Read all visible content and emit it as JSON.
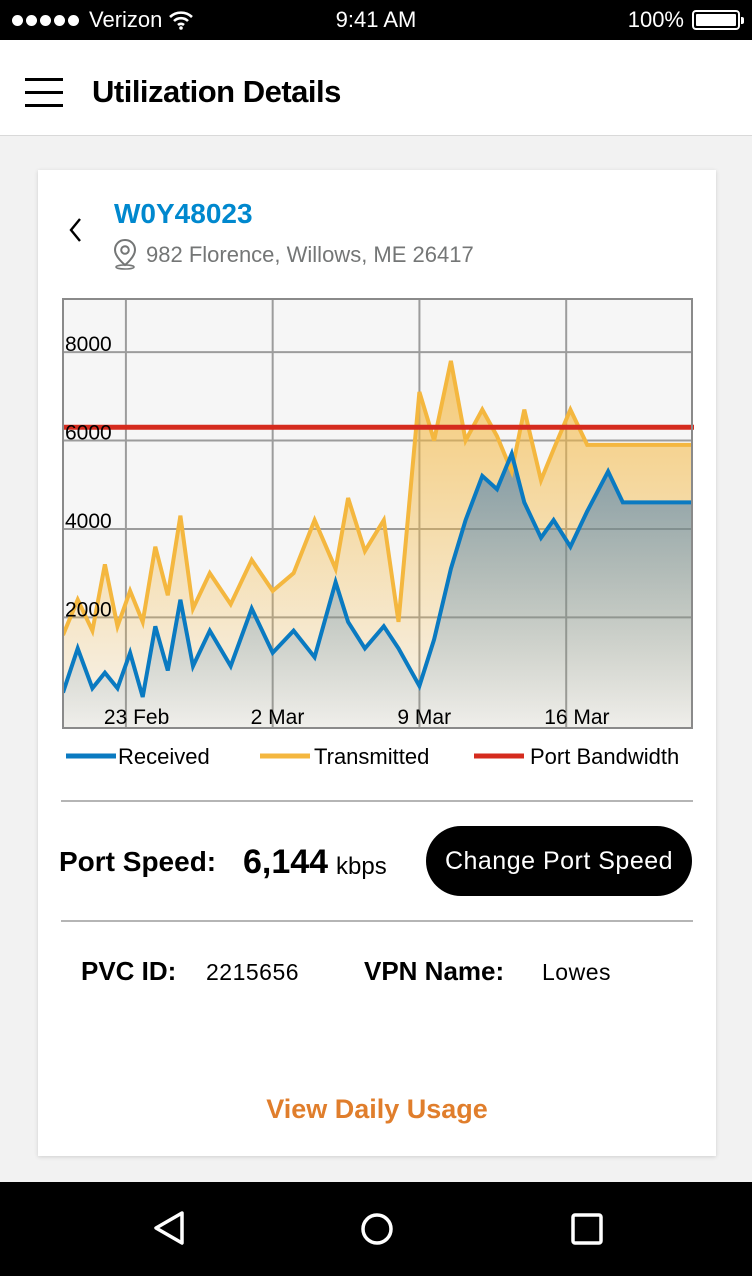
{
  "status_bar": {
    "carrier": "Verizon",
    "time": "9:41 AM",
    "battery": "100%"
  },
  "header": {
    "title": "Utilization Details"
  },
  "site": {
    "id": "W0Y48023",
    "address": "982 Florence, Willows, ME 26417"
  },
  "chart_data": {
    "type": "area",
    "x_tick_labels": [
      "23 Feb",
      "2 Mar",
      "9 Mar",
      "16 Mar"
    ],
    "x_ticks_at_day": [
      3,
      10,
      17,
      24
    ],
    "y_tick_labels": [
      "2000",
      "4000",
      "6000",
      "8000"
    ],
    "y_ticks": [
      2000,
      4000,
      6000,
      8000
    ],
    "ylim": [
      -500,
      9200
    ],
    "x_days": [
      0,
      0.7,
      1.4,
      2,
      2.6,
      3.2,
      3.8,
      4.4,
      5,
      5.6,
      6.2,
      7,
      8,
      9,
      10,
      11,
      12,
      13,
      13.6,
      14.4,
      15.3,
      16,
      17,
      17.7,
      18.5,
      19.2,
      20,
      20.7,
      21.4,
      22,
      22.8,
      23.4,
      24.2,
      25,
      26,
      26.7,
      27.4,
      28.2,
      29.2,
      30
    ],
    "series": [
      {
        "name": "Received",
        "color": "#0a7ac1",
        "values": [
          300,
          1300,
          400,
          750,
          400,
          1200,
          200,
          1800,
          800,
          2400,
          900,
          1700,
          900,
          2200,
          1200,
          1700,
          1100,
          2800,
          1900,
          1300,
          1800,
          1300,
          450,
          1500,
          3100,
          4200,
          5200,
          4900,
          5700,
          4600,
          3800,
          4200,
          3600,
          4400,
          5300,
          4600,
          4600,
          4600,
          4600,
          4600
        ],
        "fill": [
          "rgba(40,110,180,0.55)",
          "rgba(40,110,180,0.03)"
        ]
      },
      {
        "name": "Transmitted",
        "color": "#f4b73f",
        "values": [
          1600,
          2400,
          1700,
          3200,
          1800,
          2600,
          1900,
          3600,
          2500,
          4300,
          2200,
          3000,
          2300,
          3300,
          2600,
          3000,
          4200,
          3100,
          4700,
          3500,
          4200,
          1900,
          7100,
          6000,
          7800,
          6000,
          6700,
          6100,
          5300,
          6700,
          5100,
          5800,
          6700,
          5900,
          5900,
          5900,
          5900,
          5900,
          5900,
          5900
        ],
        "fill": [
          "rgba(244,183,63,0.7)",
          "rgba(244,183,63,0.05)"
        ]
      },
      {
        "name": "Port Bandwidth",
        "color": "#d52b1e",
        "constant": 6300
      }
    ],
    "grid": true,
    "legend_position": "bottom"
  },
  "legend": {
    "received": "Received",
    "transmitted": "Transmitted",
    "bandwidth": "Port Bandwidth"
  },
  "port": {
    "label": "Port Speed:",
    "value": "6,144",
    "unit": "kbps",
    "button": "Change Port Speed"
  },
  "details": {
    "pvc_label": "PVC ID:",
    "pvc_value": "2215656",
    "vpn_label": "VPN Name:",
    "vpn_value": "Lowes"
  },
  "links": {
    "daily_usage": "View Daily Usage"
  },
  "colors": {
    "accent_blue": "#0088ce",
    "link_orange": "#e07e2c",
    "bandwidth_red": "#d52b1e"
  }
}
